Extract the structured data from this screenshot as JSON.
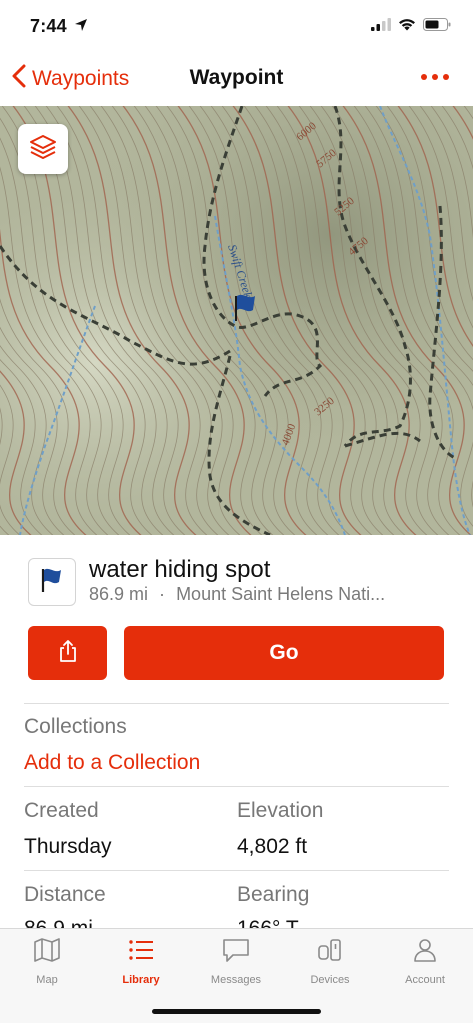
{
  "status_bar": {
    "time": "7:44"
  },
  "nav": {
    "back_label": "Waypoints",
    "title": "Waypoint"
  },
  "map": {
    "creek_label": "Swift Creek",
    "contour_labels": [
      "6000",
      "5750",
      "5250",
      "4750",
      "3250",
      "4000"
    ]
  },
  "waypoint": {
    "name": "water hiding spot",
    "distance": "86.9 mi",
    "separator": "·",
    "location": "Mount Saint Helens Nati..."
  },
  "actions": {
    "go_label": "Go"
  },
  "collections": {
    "heading": "Collections",
    "add_link": "Add to a Collection"
  },
  "details": {
    "created_label": "Created",
    "created_value": "Thursday",
    "elevation_label": "Elevation",
    "elevation_value": "4,802 ft",
    "distance_label": "Distance",
    "distance_value": "86.9 mi",
    "bearing_label": "Bearing",
    "bearing_value": "166° T"
  },
  "tabs": [
    {
      "label": "Map",
      "icon": "map-icon"
    },
    {
      "label": "Library",
      "icon": "list-icon"
    },
    {
      "label": "Messages",
      "icon": "message-icon"
    },
    {
      "label": "Devices",
      "icon": "devices-icon"
    },
    {
      "label": "Account",
      "icon": "person-icon"
    }
  ],
  "colors": {
    "accent": "#e52e0b",
    "flag": "#1f4e9c"
  }
}
